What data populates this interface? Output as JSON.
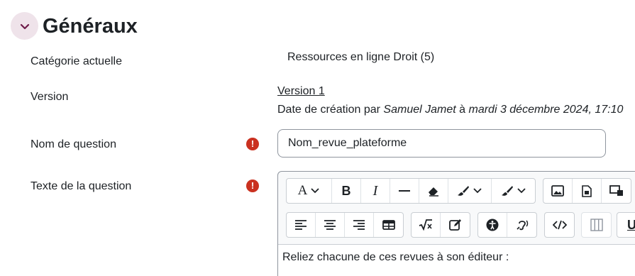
{
  "section": {
    "title": "Généraux",
    "toggle_icon": "chevron-down-icon"
  },
  "fields": {
    "category": {
      "label": "Catégorie actuelle",
      "value": "Ressources en ligne Droit (5)"
    },
    "version": {
      "label": "Version",
      "link": "Version 1",
      "created_prefix": "Date de création par ",
      "author": "Samuel Jamet",
      "created_mid": " à ",
      "date": "mardi 3 décembre 2024, 17:10"
    },
    "name": {
      "label": "Nom de question",
      "value": "Nom_revue_plateforme",
      "required": true
    },
    "text": {
      "label": "Texte de la question",
      "required": true,
      "content": "Reliez chacune de ces revues à son éditeur :"
    }
  },
  "editor_toolbar": {
    "row1": [
      {
        "name": "font-size-button",
        "icon": "font-size-icon",
        "glyph": "A",
        "dropdown": true
      },
      {
        "name": "bold-button",
        "icon": "bold-icon",
        "glyph": "B"
      },
      {
        "name": "italic-button",
        "icon": "italic-icon",
        "glyph": "I"
      },
      {
        "name": "horizontal-line-button",
        "icon": "horizontal-line-icon",
        "glyph": "—"
      },
      {
        "name": "clear-format-button",
        "icon": "eraser-icon"
      },
      {
        "name": "text-color-button",
        "icon": "brush-icon",
        "dropdown": true
      },
      {
        "name": "background-color-button",
        "icon": "brush-icon",
        "dropdown": true
      },
      {
        "name": "image-button",
        "icon": "image-icon"
      },
      {
        "name": "media-button",
        "icon": "media-icon"
      },
      {
        "name": "h5p-button",
        "icon": "h5p-icon"
      }
    ],
    "row2": [
      {
        "name": "align-left-button",
        "icon": "align-left-icon"
      },
      {
        "name": "align-center-button",
        "icon": "align-center-icon"
      },
      {
        "name": "align-right-button",
        "icon": "align-right-icon"
      },
      {
        "name": "table-button",
        "icon": "table-icon"
      },
      {
        "name": "equation-button",
        "icon": "sqrt-icon"
      },
      {
        "name": "edit-button",
        "icon": "pencil-icon"
      },
      {
        "name": "accessibility-button",
        "icon": "accessibility-icon"
      },
      {
        "name": "screenreader-button",
        "icon": "ear-icon"
      },
      {
        "name": "html-button",
        "icon": "code-icon"
      },
      {
        "name": "columns-button",
        "icon": "columns-icon"
      },
      {
        "name": "underline-button",
        "icon": "underline-icon",
        "glyph": "U"
      }
    ]
  },
  "colors": {
    "accent": "#ca3120",
    "toggle_bg": "#efe3ea",
    "border": "#8f959e"
  }
}
